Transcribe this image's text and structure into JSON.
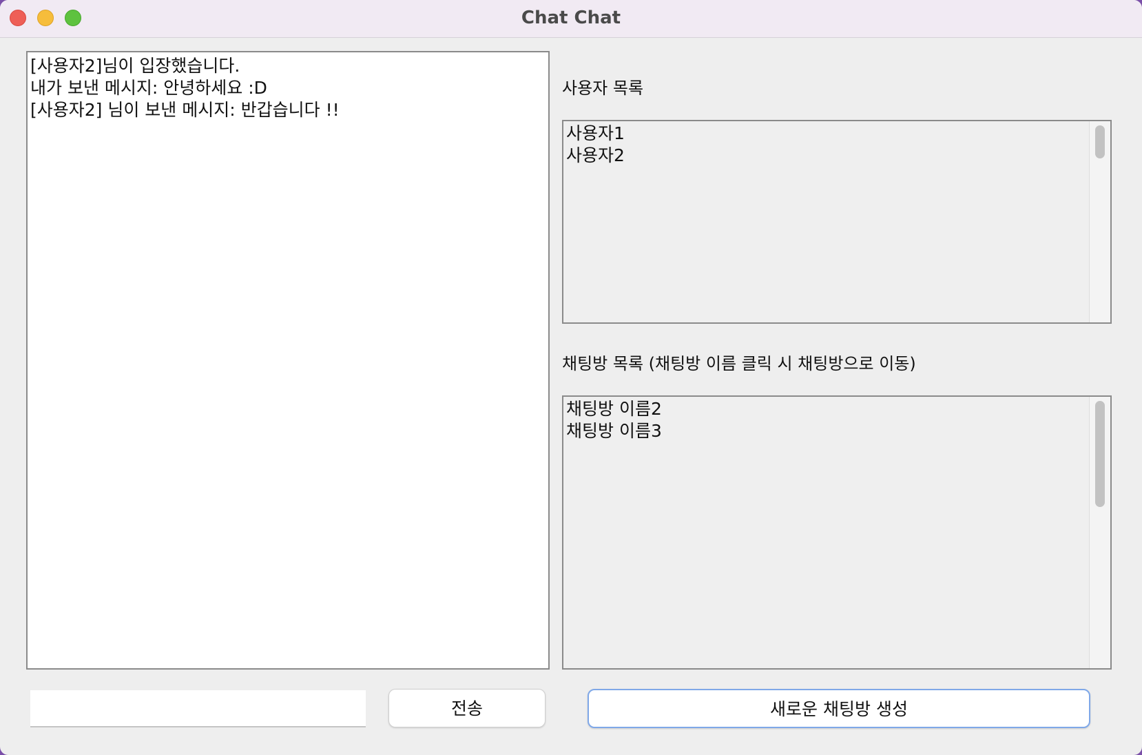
{
  "window": {
    "title": "Chat Chat"
  },
  "chat": {
    "messages": [
      "[사용자2]님이 입장했습니다.",
      "내가 보낸 메시지: 안녕하세요 :D",
      "[사용자2] 님이 보낸 메시지: 반갑습니다 !!"
    ]
  },
  "users": {
    "label": "사용자 목록",
    "items": [
      "사용자1",
      "사용자2"
    ]
  },
  "rooms": {
    "label": "채팅방 목록 (채팅방 이름 클릭 시 채팅방으로 이동)",
    "items": [
      "채팅방 이름2",
      "채팅방 이름3"
    ]
  },
  "input": {
    "value": ""
  },
  "buttons": {
    "send": "전송",
    "create_room": "새로운 채팅방 생성"
  }
}
